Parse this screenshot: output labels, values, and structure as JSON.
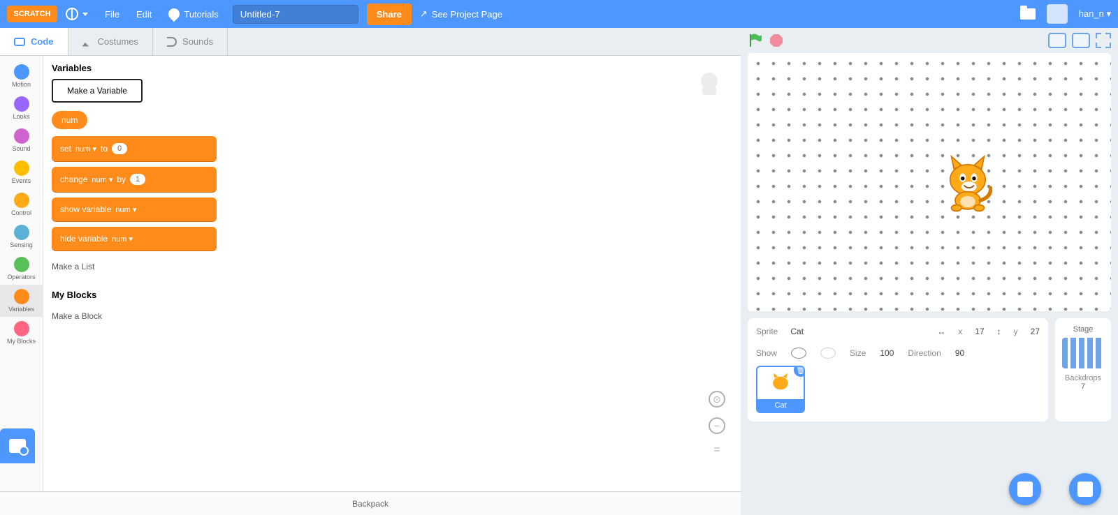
{
  "topbar": {
    "logo": "SCRATCH",
    "file": "File",
    "edit": "Edit",
    "tutorials": "Tutorials",
    "project_title": "Untitled-7",
    "share": "Share",
    "see_project": "See Project Page",
    "username": "han_n ▾"
  },
  "tabs": {
    "code": "Code",
    "costumes": "Costumes",
    "sounds": "Sounds"
  },
  "categories": [
    {
      "label": "Motion",
      "color": "#4c97ff"
    },
    {
      "label": "Looks",
      "color": "#9966ff"
    },
    {
      "label": "Sound",
      "color": "#cf63cf"
    },
    {
      "label": "Events",
      "color": "#ffbf00"
    },
    {
      "label": "Control",
      "color": "#ffab19"
    },
    {
      "label": "Sensing",
      "color": "#5cb1d6"
    },
    {
      "label": "Operators",
      "color": "#59c059"
    },
    {
      "label": "Variables",
      "color": "#ff8c1a"
    },
    {
      "label": "My Blocks",
      "color": "#ff6680"
    }
  ],
  "palette": {
    "section1_title": "Variables",
    "make_variable": "Make a Variable",
    "var_name": "num",
    "blk_set": "set",
    "blk_set_to": "to",
    "blk_set_val": "0",
    "blk_change": "change",
    "blk_change_by": "by",
    "blk_change_val": "1",
    "blk_show": "show variable",
    "blk_hide": "hide variable",
    "dd_var": "num ▾",
    "make_list": "Make a List",
    "section2_title": "My Blocks",
    "make_block": "Make a Block"
  },
  "backpack": "Backpack",
  "sprite_info": {
    "sprite_lbl": "Sprite",
    "sprite_name": "Cat",
    "x_lbl": "x",
    "x_val": "17",
    "y_lbl": "y",
    "y_val": "27",
    "show_lbl": "Show",
    "size_lbl": "Size",
    "size_val": "100",
    "dir_lbl": "Direction",
    "dir_val": "90",
    "tile_label": "Cat"
  },
  "stage_panel": {
    "title": "Stage",
    "backdrops_lbl": "Backdrops",
    "backdrops_count": "7"
  }
}
